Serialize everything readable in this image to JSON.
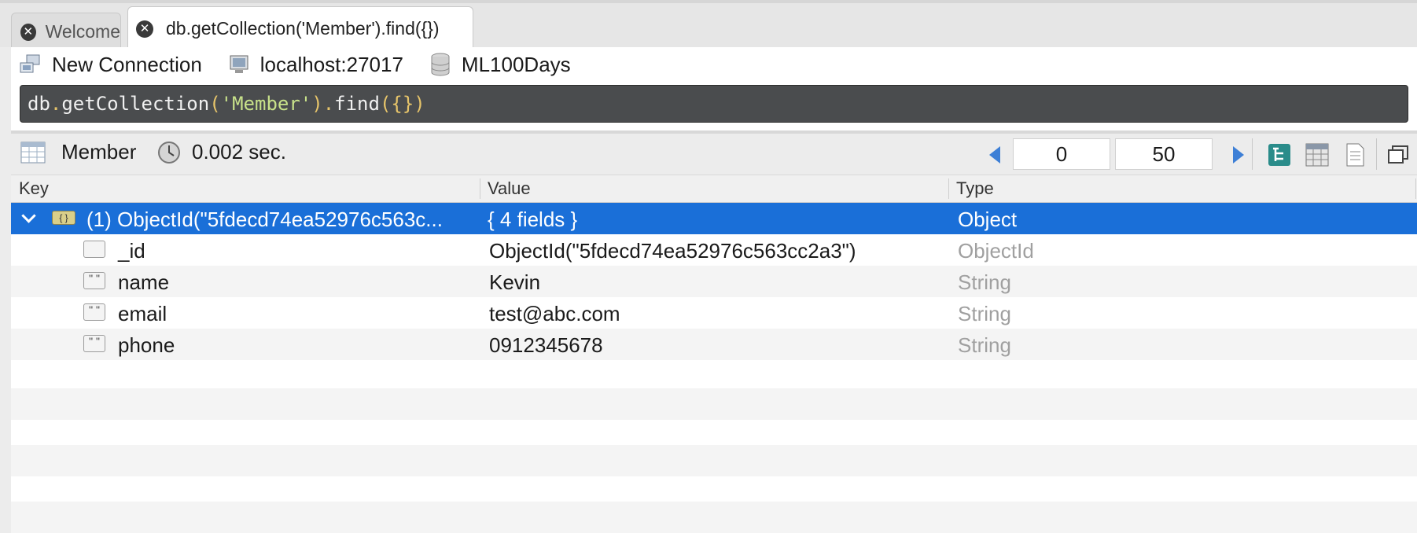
{
  "tabs": [
    {
      "label": "Welcome",
      "close_icon": "close-icon"
    },
    {
      "label": "db.getCollection('Member').find({})",
      "close_icon": "close-icon",
      "active": true
    }
  ],
  "connection": {
    "name": "New Connection",
    "server": "localhost:27017",
    "database": "ML100Days"
  },
  "editor": {
    "query_parts": [
      "db",
      ".",
      "getCollection",
      "(",
      "'Member'",
      ").",
      "find",
      "({})"
    ]
  },
  "results_toolbar": {
    "collection": "Member",
    "time": "0.002 sec.",
    "skip": "0",
    "limit": "50"
  },
  "table": {
    "columns": [
      "Key",
      "Value",
      "Type"
    ],
    "root": {
      "key": "(1) ObjectId(\"5fdecd74ea52976c563c...",
      "value": "{ 4 fields }",
      "type": "Object"
    },
    "rows": [
      {
        "key": "_id",
        "value": "ObjectId(\"5fdecd74ea52976c563cc2a3\")",
        "type": "ObjectId",
        "icon": "blank-field-icon"
      },
      {
        "key": "name",
        "value": "Kevin",
        "type": "String",
        "icon": "string-icon"
      },
      {
        "key": "email",
        "value": "test@abc.com",
        "type": "String",
        "icon": "string-icon"
      },
      {
        "key": "phone",
        "value": "0912345678",
        "type": "String",
        "icon": "string-icon"
      }
    ]
  },
  "colors": {
    "selection": "#1a6fd8",
    "editor_bg": "#4a4c4e",
    "accent_blue": "#3d7fd6"
  }
}
